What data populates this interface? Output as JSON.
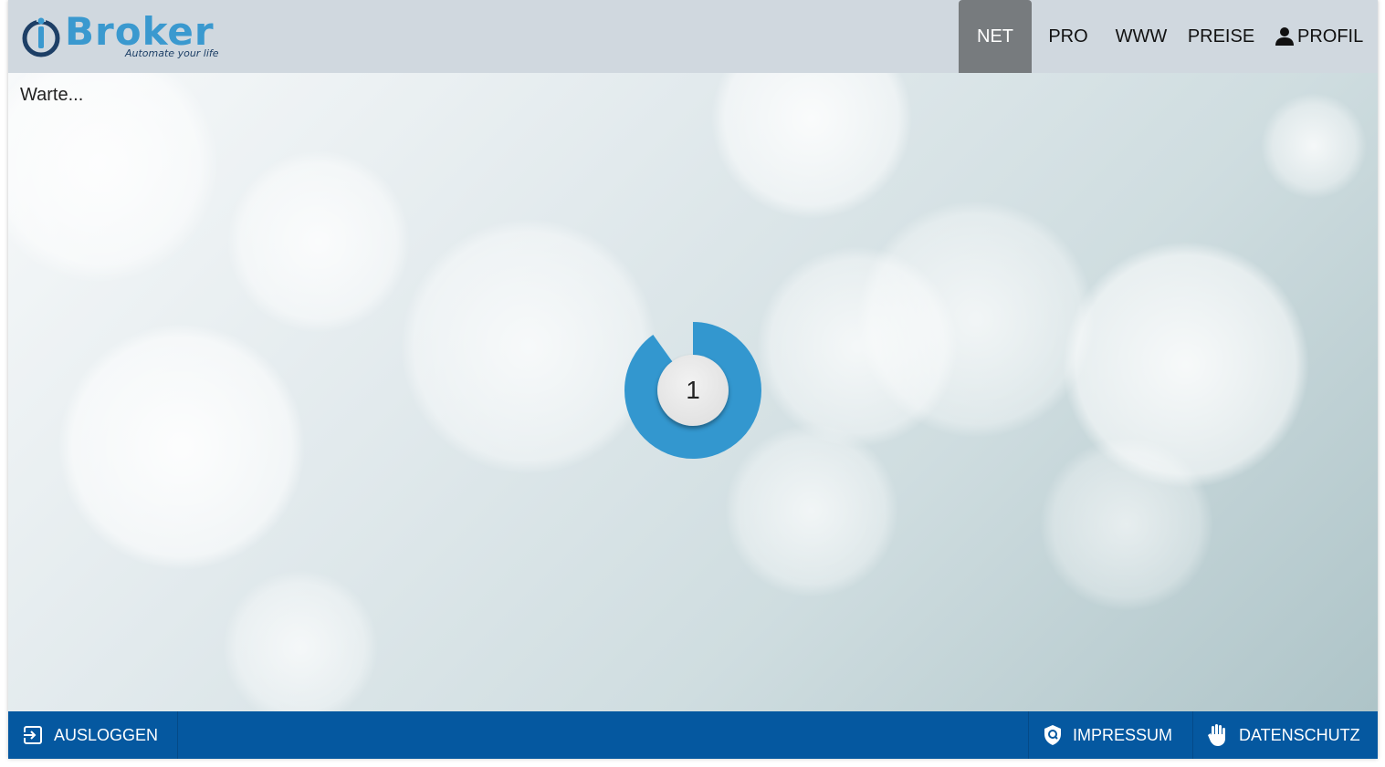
{
  "header": {
    "logo": {
      "brand": "Broker",
      "tagline": "Automate your life",
      "icon": "iobroker-power-icon"
    },
    "nav": [
      {
        "label": "NET",
        "active": true
      },
      {
        "label": "PRO",
        "active": false
      },
      {
        "label": "WWW",
        "active": false
      },
      {
        "label": "PREISE",
        "active": false
      },
      {
        "label": "PROFIL",
        "active": false,
        "icon": "person-icon"
      }
    ]
  },
  "main": {
    "status_text": "Warte...",
    "countdown": {
      "value": "1",
      "progress": 0.9
    }
  },
  "footer": {
    "logout": {
      "label": "AUSLOGGEN",
      "icon": "logout-icon"
    },
    "impressum": {
      "label": "IMPRESSUM",
      "icon": "shield-icon"
    },
    "datenschutz": {
      "label": "DATENSCHUTZ",
      "icon": "hand-icon"
    }
  },
  "colors": {
    "header_bg": "#d0d8df",
    "nav_active_bg": "#777b7e",
    "accent": "#3a99cf",
    "footer_bg": "#0558a0"
  }
}
